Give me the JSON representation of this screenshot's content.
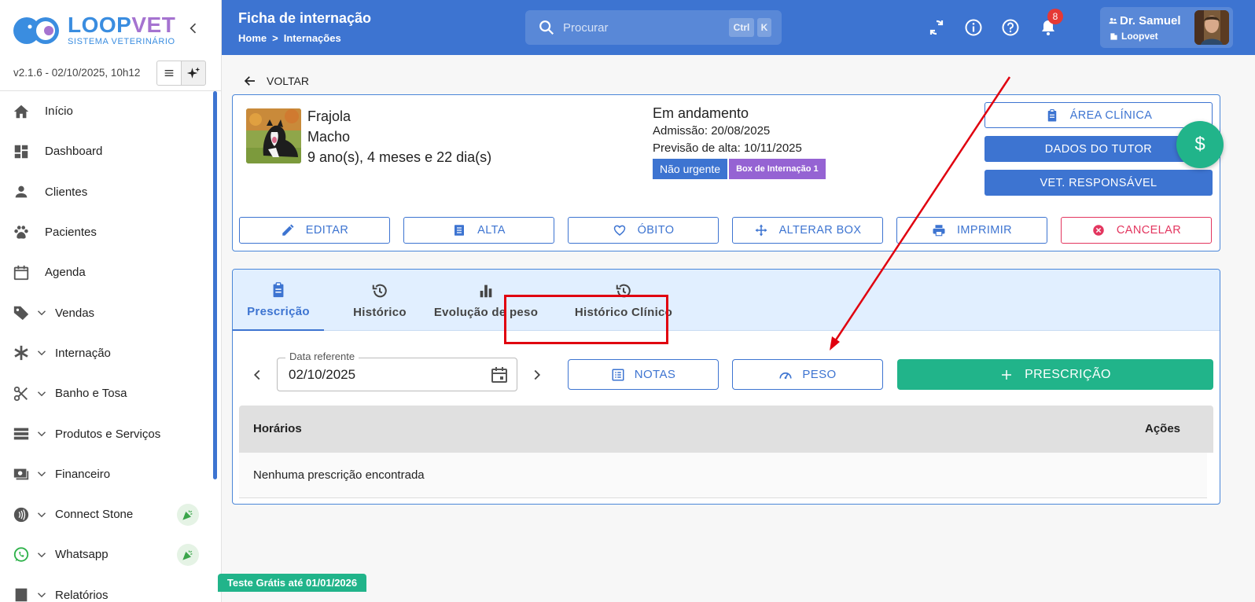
{
  "brand": {
    "name_part1": "LOOP",
    "name_part2": "VET",
    "subtitle": "SISTEMA VETERINÁRIO",
    "version": "v2.1.6 - 02/10/2025, 10h12"
  },
  "sidebar": {
    "items": [
      {
        "label": "Início",
        "icon": "home-icon"
      },
      {
        "label": "Dashboard",
        "icon": "dashboard-icon"
      },
      {
        "label": "Clientes",
        "icon": "person-icon"
      },
      {
        "label": "Pacientes",
        "icon": "paw-icon"
      },
      {
        "label": "Agenda",
        "icon": "calendar-icon"
      },
      {
        "label": "Vendas",
        "icon": "tag-icon"
      },
      {
        "label": "Internação",
        "icon": "asterisk-icon"
      },
      {
        "label": "Banho e Tosa",
        "icon": "scissors-icon"
      },
      {
        "label": "Produtos e Serviços",
        "icon": "storage-icon"
      },
      {
        "label": "Financeiro",
        "icon": "money-icon"
      },
      {
        "label": "Connect Stone",
        "icon": "contactless-icon"
      },
      {
        "label": "Whatsapp",
        "icon": "whatsapp-icon"
      },
      {
        "label": "Relatórios",
        "icon": "report-icon"
      }
    ]
  },
  "header": {
    "title": "Ficha de internação",
    "breadcrumb": [
      "Home",
      ">",
      "Internações"
    ],
    "search_placeholder": "Procurar",
    "shortcut": [
      "Ctrl",
      "K"
    ],
    "notification_count": "8",
    "user_name": "Dr. Samuel",
    "user_org": "Loopvet"
  },
  "patient": {
    "back_label": "VOLTAR",
    "name": "Frajola",
    "sex": "Macho",
    "age": "9 ano(s), 4 meses e 22 dia(s)",
    "status": "Em andamento",
    "admission": "Admissão: 20/08/2025",
    "discharge_forecast": "Previsão de alta: 10/11/2025",
    "urgency": "Não urgente",
    "box": "Box de Internação 1",
    "fab_symbol": "$"
  },
  "side_buttons": {
    "clinical_area": "ÁREA CLÍNICA",
    "tutor_data": "DADOS DO TUTOR",
    "vet_responsible": "VET. RESPONSÁVEL"
  },
  "actions": {
    "edit": "EDITAR",
    "discharge": "ALTA",
    "death": "ÓBITO",
    "change_box": "ALTERAR BOX",
    "print": "IMPRIMIR",
    "cancel": "CANCELAR"
  },
  "tabs": {
    "prescription": "Prescrição",
    "history": "Histórico",
    "weight": "Evolução de peso",
    "clinical_history": "Histórico Clínico"
  },
  "prescription": {
    "date_label": "Data referente",
    "date_value": "02/10/2025",
    "notes": "NOTAS",
    "weight": "PESO",
    "add": "PRESCRIÇÃO",
    "col_times": "Horários",
    "col_actions": "Ações",
    "empty": "Nenhuma prescrição encontrada"
  },
  "trial": "Teste Grátis até 01/01/2026",
  "colors": {
    "primary": "#3d74d1",
    "accent_green": "#21b48a",
    "danger": "#e3365f",
    "purple": "#9563d3",
    "annotation_red": "#e0000f"
  }
}
